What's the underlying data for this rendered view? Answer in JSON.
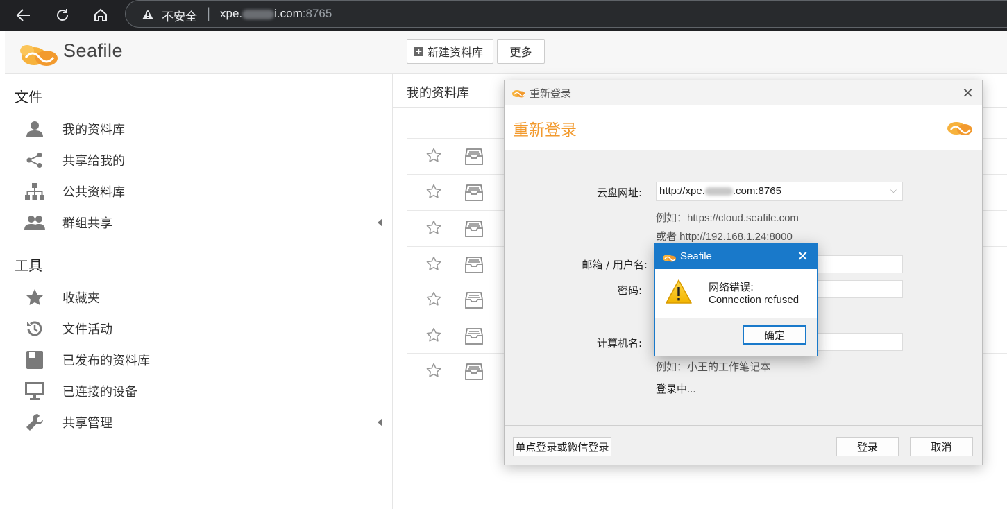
{
  "browser": {
    "security_label": "不安全",
    "url_host": "xpe.",
    "url_host_end": "i.com",
    "url_port": ":8765"
  },
  "app": {
    "name": "Seafile",
    "new_library_label": "新建资料库",
    "more_label": "更多"
  },
  "sidebar": {
    "files_heading": "文件",
    "tools_heading": "工具",
    "files_items": [
      {
        "label": "我的资料库",
        "icon": "user-icon"
      },
      {
        "label": "共享给我的",
        "icon": "share-icon"
      },
      {
        "label": "公共资料库",
        "icon": "org-tree-icon"
      },
      {
        "label": "群组共享",
        "icon": "group-icon"
      }
    ],
    "tools_items": [
      {
        "label": "收藏夹",
        "icon": "star-icon"
      },
      {
        "label": "文件活动",
        "icon": "history-icon"
      },
      {
        "label": "已发布的资料库",
        "icon": "published-icon"
      },
      {
        "label": "已连接的设备",
        "icon": "monitor-icon"
      },
      {
        "label": "共享管理",
        "icon": "wrench-icon"
      }
    ]
  },
  "main": {
    "title": "我的资料库",
    "row_count": 7
  },
  "relogin_dialog": {
    "window_title": "重新登录",
    "banner_title": "重新登录",
    "server_label": "云盘网址:",
    "server_value_start": "http://xpe.",
    "server_value_end": ".com:8765",
    "example_1": "例如：https://cloud.seafile.com",
    "example_2": "或者 http://192.168.1.24:8000",
    "email_label": "邮箱 / 用户名:",
    "password_label": "密码:",
    "computer_label": "计算机名:",
    "computer_example": "例如：小王的工作笔记本",
    "status": "登录中...",
    "sso_button": "单点登录或微信登录",
    "login_button": "登录",
    "cancel_button": "取消"
  },
  "error_box": {
    "title": "Seafile",
    "line1": "网络错误:",
    "line2": "Connection refused",
    "ok_button": "确定"
  },
  "colors": {
    "brand_orange": "#f29a2e",
    "msgbox_blue": "#1979ca",
    "browser_dark": "#202124"
  }
}
